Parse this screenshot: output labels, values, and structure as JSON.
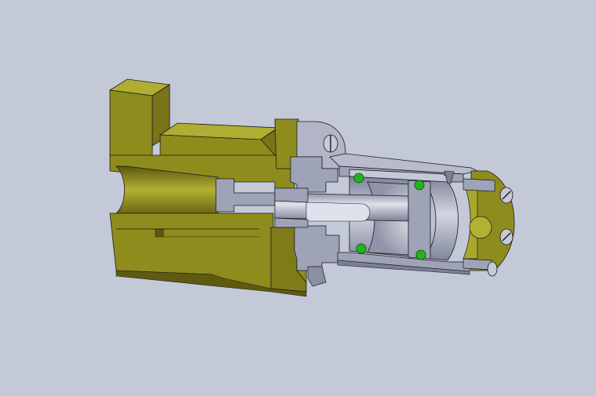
{
  "colors": {
    "background": "#c3c9d6",
    "housing_face": "#8f8c1e",
    "housing_light": "#a9a62c",
    "housing_dark": "#6e6b12",
    "housing_shadow": "#4c4a0a",
    "steel_face": "#9ea3b8",
    "steel_light": "#c3c7d6",
    "steel_dark": "#6e7388",
    "seal": "#1fb51f",
    "edge": "#1a1a1a"
  },
  "parts": [
    {
      "id": "housing",
      "label": "",
      "material": "olive"
    },
    {
      "id": "flange-plate",
      "label": "",
      "material": "steel"
    },
    {
      "id": "cylinder-body",
      "label": "",
      "material": "steel"
    },
    {
      "id": "piston-rod",
      "label": "",
      "material": "steel"
    },
    {
      "id": "piston",
      "label": "",
      "material": "steel"
    },
    {
      "id": "end-cap",
      "label": "",
      "material": "olive"
    },
    {
      "id": "o-ring-seals",
      "label": "",
      "material": "rubber"
    }
  ]
}
